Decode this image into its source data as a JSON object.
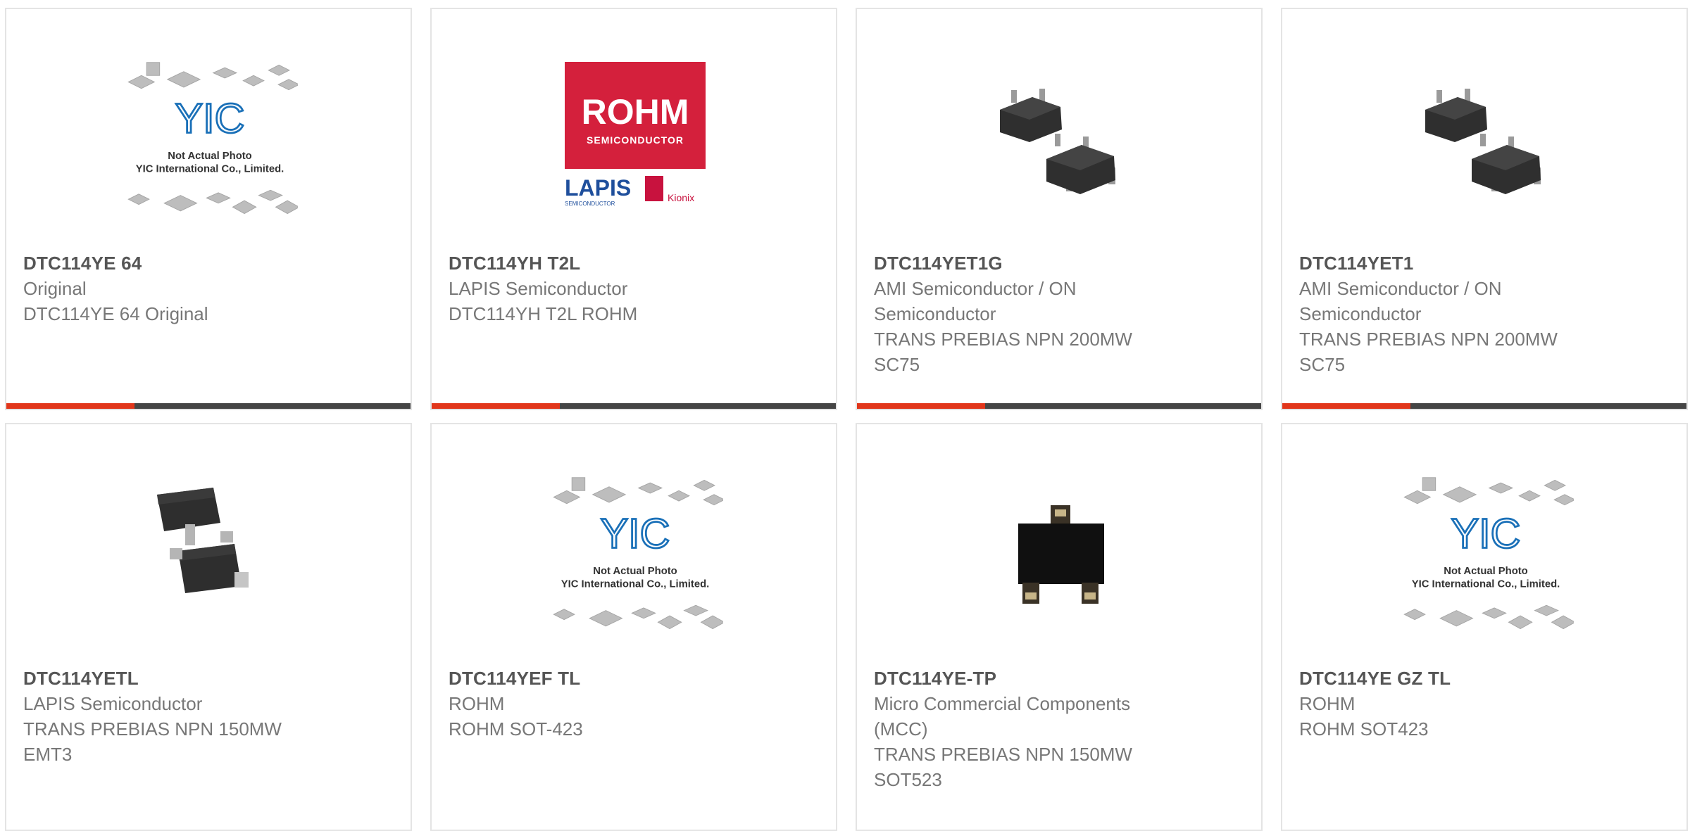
{
  "colors": {
    "accent": "#e1361b",
    "bar_dark": "#454545",
    "card_border": "#e4e4e4",
    "title_text": "#555555",
    "body_text": "#777777"
  },
  "placeholder": {
    "text_line1": "Not Actual Photo",
    "text_line2": "YIC International Co., Limited.",
    "logo_text": "YIC"
  },
  "rohm_logo": {
    "brand": "ROHM",
    "tagline": "SEMICONDUCTOR",
    "lapis": "LAPIS",
    "lapis_sub": "SEMICONDUCTOR",
    "kionix": "Kionix"
  },
  "products": [
    {
      "part": "DTC114YE 64",
      "lines": [
        "Original",
        "DTC114YE 64 Original"
      ],
      "image": "placeholder"
    },
    {
      "part": "DTC114YH T2L",
      "lines": [
        "LAPIS Semiconductor",
        "DTC114YH T2L ROHM"
      ],
      "image": "rohm-logo"
    },
    {
      "part": "DTC114YET1G",
      "lines": [
        "AMI Semiconductor / ON Semiconductor",
        "TRANS PREBIAS NPN 200MW SC75"
      ],
      "image": "sc75-package"
    },
    {
      "part": "DTC114YET1",
      "lines": [
        "AMI Semiconductor / ON Semiconductor",
        "TRANS PREBIAS NPN 200MW SC75"
      ],
      "image": "sc75-package"
    },
    {
      "part": "DTC114YETL",
      "lines": [
        "LAPIS Semiconductor",
        "TRANS PREBIAS NPN 150MW EMT3"
      ],
      "image": "emt3-package"
    },
    {
      "part": "DTC114YEF TL",
      "lines": [
        "ROHM",
        "ROHM SOT-423"
      ],
      "image": "placeholder"
    },
    {
      "part": "DTC114YE-TP",
      "lines": [
        "Micro Commercial Components (MCC)",
        "TRANS PREBIAS NPN 150MW SOT523"
      ],
      "image": "sot523-package"
    },
    {
      "part": "DTC114YE GZ TL",
      "lines": [
        "ROHM",
        "ROHM SOT423"
      ],
      "image": "placeholder"
    }
  ]
}
